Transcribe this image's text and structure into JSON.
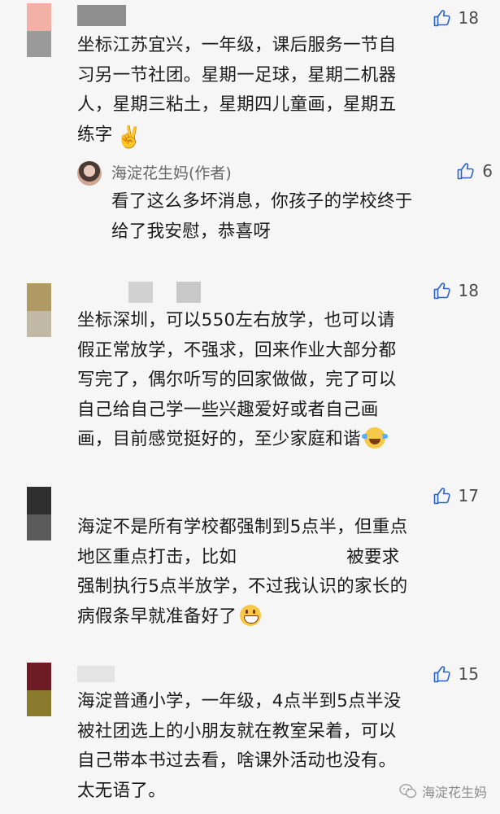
{
  "comments": [
    {
      "likes": "18",
      "lines": [
        "坐标江苏宜兴，一年级，课后服务一节自",
        "习另一节社团。星期一足球，星期二机器",
        "人，星期三粘土，星期四儿童画，星期五",
        "练字"
      ],
      "emoji": "victory-emoji",
      "avatar_colors": [
        "#f3b0a6",
        "#9a9a9a"
      ],
      "reply": {
        "name": "海淀花生妈(作者)",
        "likes": "6",
        "lines": [
          "看了这么多坏消息，你孩子的学校终于",
          "给了我安慰，恭喜呀"
        ]
      }
    },
    {
      "likes": "18",
      "lines": [
        "坐标深圳，可以550左右放学，也可以请",
        "假正常放学，不强求，回来作业大部分都",
        "写完了，偶尔听写的回家做做，完了可以",
        "自己给自己学一些兴趣爱好或者自己画",
        "画，目前感觉挺好的，至少家庭和谐"
      ],
      "emoji": "tears-of-joy-emoji",
      "avatar_colors": [
        "#b09a63",
        "#c2b8a6"
      ]
    },
    {
      "likes": "17",
      "line1": "海淀不是所有学校都强制到5点半，但重点",
      "line2a": "地区重点打击，比如",
      "line2b": "被要求",
      "line3": "强制执行5点半放学，不过我认识的家长的",
      "line4": "病假条早就准备好了",
      "emoji": "grinning-emoji",
      "avatar_colors": [
        "#2f2f2f",
        "#5a5a5a"
      ]
    },
    {
      "likes": "15",
      "lines": [
        "海淀普通小学，一年级，4点半到5点半没",
        "被社团选上的小朋友就在教室呆着，可以",
        "自己带本书过去看，啥课外活动也没有。",
        "太无语了。"
      ],
      "avatar_colors": [
        "#6e1b26",
        "#8a7a2e"
      ]
    }
  ],
  "watermark": {
    "text": "海淀花生妈"
  },
  "icons": {
    "like": "thumbs-up-icon",
    "watermark": "wechat-icon"
  }
}
